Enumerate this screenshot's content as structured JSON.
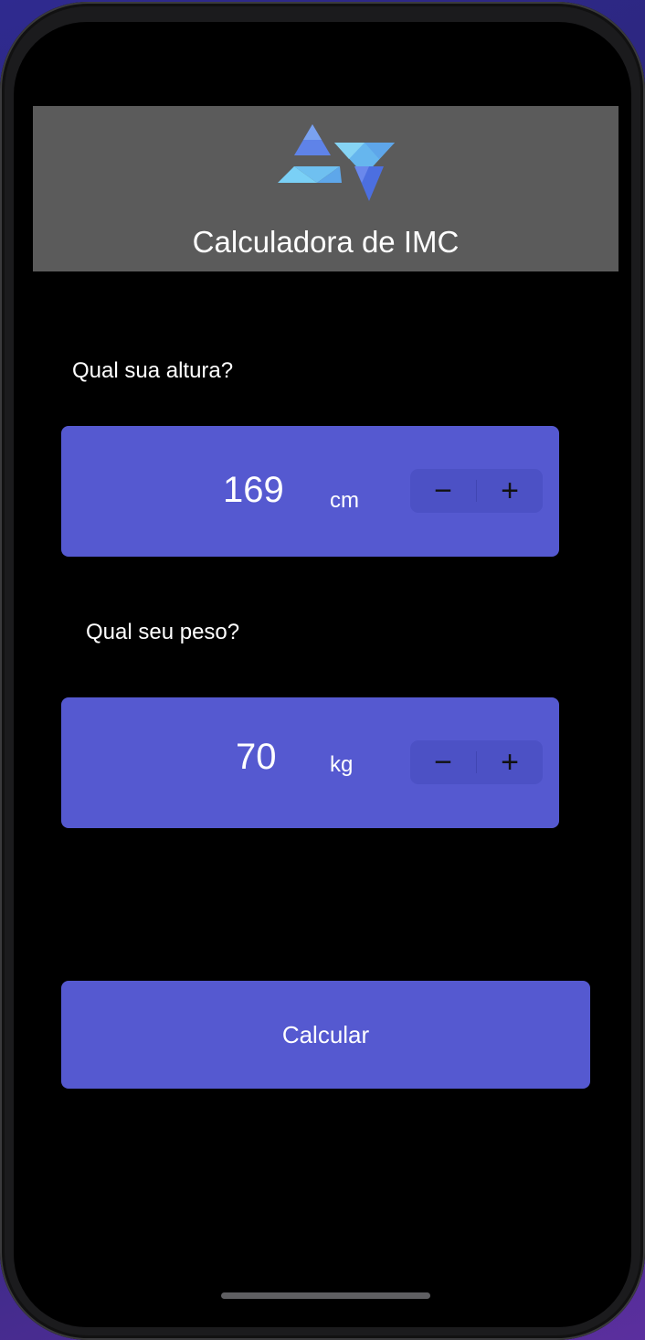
{
  "header": {
    "title": "Calculadora de IMC",
    "logo": "triangles-logo"
  },
  "height": {
    "question": "Qual sua altura?",
    "value": "169",
    "unit": "cm",
    "decrement_label": "−",
    "increment_label": "+"
  },
  "weight": {
    "question": "Qual seu peso?",
    "value": "70",
    "unit": "kg",
    "decrement_label": "−",
    "increment_label": "+"
  },
  "actions": {
    "calculate_label": "Calcular"
  },
  "colors": {
    "accent": "#5559d0",
    "stepper": "#4c51c5",
    "header_bg": "#5b5b5b",
    "screen_bg": "#000000"
  }
}
